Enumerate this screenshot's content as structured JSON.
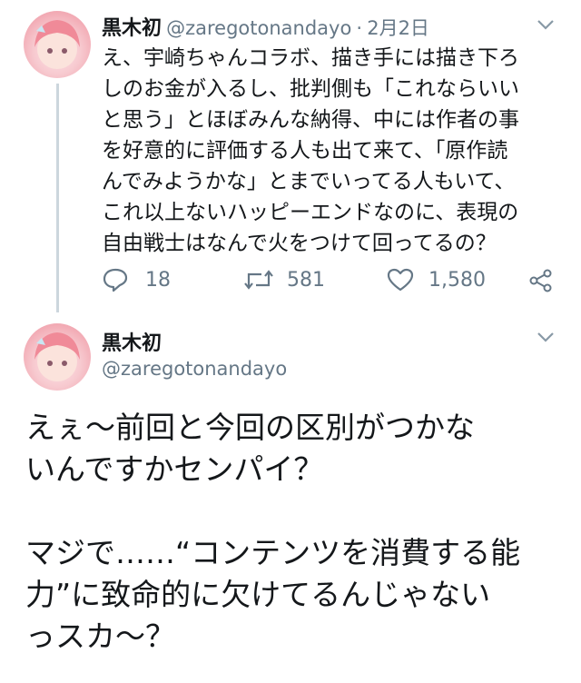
{
  "tweet1": {
    "name": "黒木初",
    "handle": "@zaregotonandayo",
    "separator": "·",
    "date": "2月2日",
    "text": "え、宇崎ちゃんコラボ、描き手には描き下ろ\nしのお金が入るし、批判側も「これならいい\nと思う」とほぼみんな納得、中には作者の事\nを好意的に評価する人も出て来て、「原作読\nんでみようかな」とまでいってる人もいて、\nこれ以上ないハッピーエンドなのに、表現の\n自由戦士はなんで火をつけて回ってるの？",
    "replies": "18",
    "retweets": "581",
    "likes": "1,580"
  },
  "tweet2": {
    "name": "黒木初",
    "handle": "@zaregotonandayo",
    "text": "えぇ〜前回と今回の区別がつかな\nいんですかセンパイ？\n\nマジで……“コンテンツを消費する能\n力”に致命的に欠けてるんじゃない\nっスカ〜？"
  },
  "icons": [
    "reply-icon",
    "retweet-icon",
    "like-icon",
    "share-icon",
    "chevron-down-icon"
  ],
  "colors": {
    "text": "#14171a",
    "secondary": "#657786",
    "line": "#ccd6dd"
  }
}
